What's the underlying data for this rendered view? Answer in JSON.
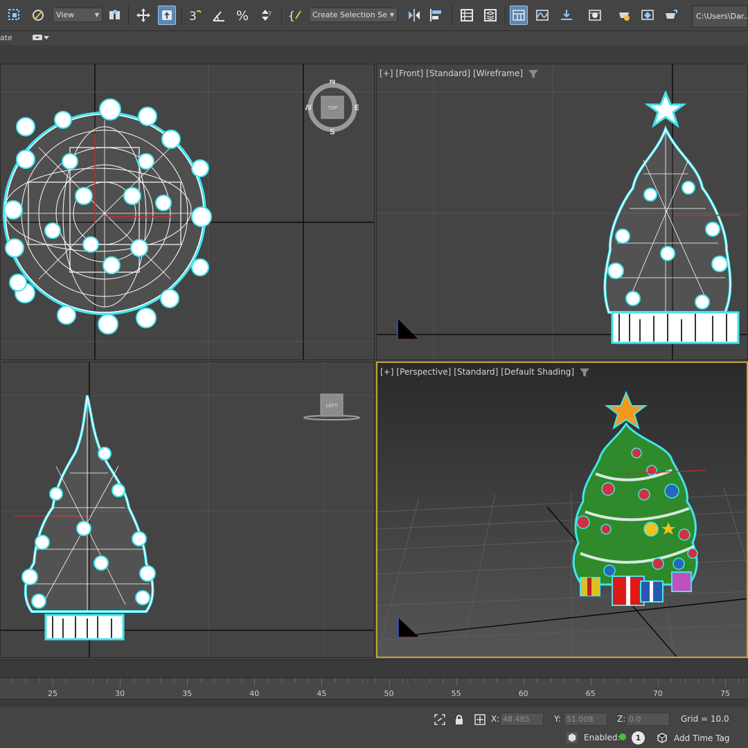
{
  "toolbar": {
    "view_dropdown": "View",
    "selection_set_dropdown": "Create Selection Se",
    "path": "C:\\Users\\Dar..."
  },
  "subbar": {
    "left_label": "ate"
  },
  "viewports": {
    "top": {
      "compass": {
        "n": "N",
        "s": "S",
        "e": "E",
        "w": "W",
        "cube": "TOP"
      }
    },
    "front": {
      "label": [
        "[+]",
        "[Front]",
        "[Standard]",
        "[Wireframe]"
      ]
    },
    "left": {
      "cube": "LEFT"
    },
    "perspective": {
      "label": [
        "[+]",
        "[Perspective]",
        "[Standard]",
        "[Default Shading]"
      ]
    }
  },
  "timeline": {
    "ticks": [
      "25",
      "30",
      "35",
      "40",
      "45",
      "50",
      "55",
      "60",
      "65",
      "70",
      "75"
    ]
  },
  "status": {
    "x_label": "X:",
    "x_value": "48.485",
    "y_label": "Y:",
    "y_value": "51.008",
    "z_label": "Z:",
    "z_value": "0.0",
    "grid": "Grid = 10.0",
    "enabled_label": "Enabled:",
    "enabled_count": "1",
    "add_time_tag": "Add Time Tag"
  },
  "colors": {
    "wire_glow": "#41e6ee",
    "active_border": "#c8a23c",
    "tree_green": "#2e8a2a",
    "star_orange": "#f39a1c"
  }
}
